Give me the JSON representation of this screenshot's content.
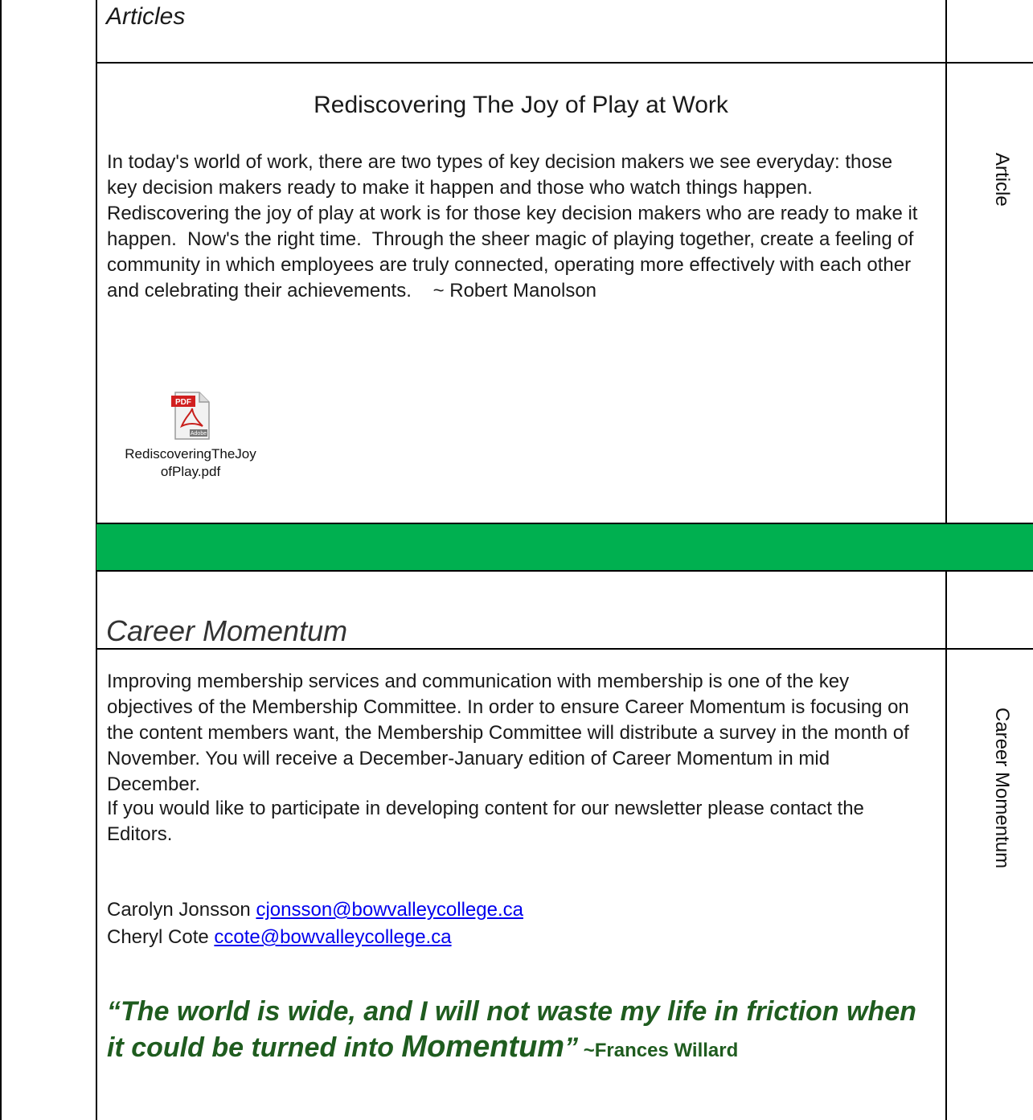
{
  "articles_section": {
    "title": "Articles",
    "heading": "Rediscovering The Joy of Play at Work",
    "body": "In today's world of work, there are two types of key decision makers we see everyday: those key decision makers ready to make it happen and those who watch things happen.  Rediscovering the joy of play at work is for those key decision makers who are ready to make it happen.  Now's the right time.  Through the sheer magic of playing together, create a feeling of community in which employees are truly connected, operating more effectively with each other and celebrating their achievements.    ~ Robert Manolson",
    "attachment": {
      "icon": "pdf-icon",
      "icon_badge": "PDF",
      "icon_brand": "Adobe",
      "filename_line1": "RediscoveringTheJoy",
      "filename_line2": "ofPlay.pdf"
    },
    "side_label": "Article"
  },
  "separator": {
    "color": "#00b050"
  },
  "career_section": {
    "title": "Career Momentum",
    "paragraph1": "Improving membership services and communication with membership is one of the key objectives of the Membership Committee.  In order to ensure Career Momentum is focusing on the content members want, the Membership Committee will distribute a survey in the month of November.  You will receive a December-January edition of Career Momentum in mid December.",
    "paragraph2": "If you would like to participate in developing content for our newsletter please contact the Editors.",
    "contacts": [
      {
        "name": "Carolyn Jonsson",
        "email": "cjonsson@bowvalleycollege.ca"
      },
      {
        "name": "Cheryl Cote",
        "email": "ccote@bowvalleycollege.ca"
      }
    ],
    "quote": {
      "text": "“The world is wide, and I will not waste my life in friction when it could be turned into ",
      "emphasis": "Momentum",
      "closing": "”",
      "author": " ~Frances Willard",
      "color": "#1f5c1f"
    },
    "side_label": "Career Momentum"
  }
}
